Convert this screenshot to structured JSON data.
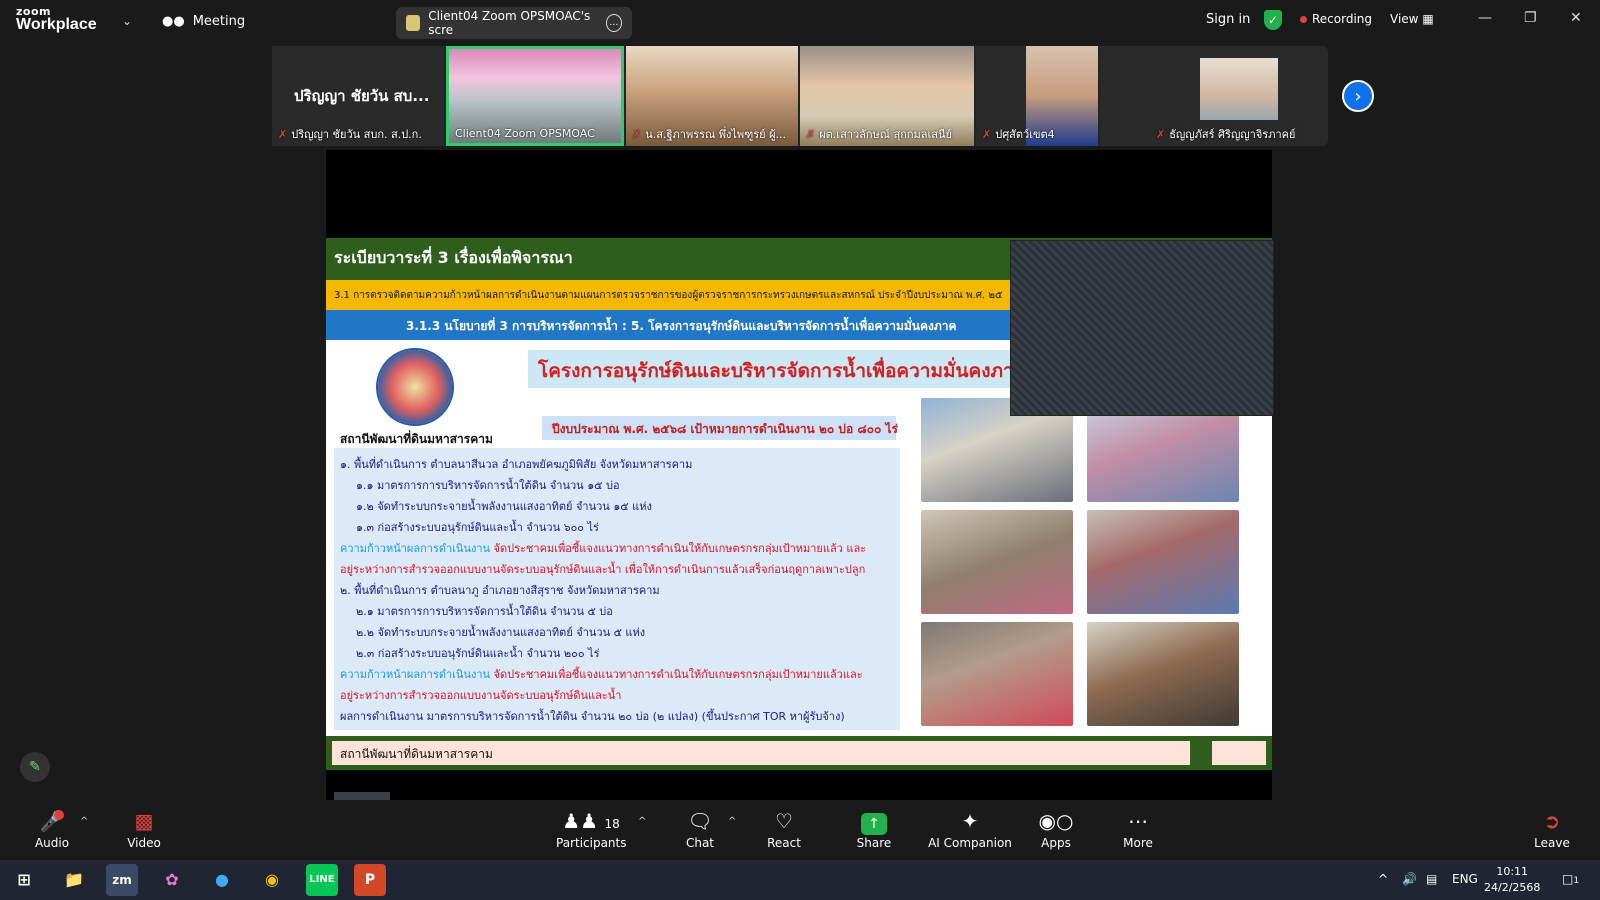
{
  "app": {
    "logo_line1": "zoom",
    "logo_line2": "Workplace",
    "meeting_label": "Meeting",
    "share_pill": "Client04 Zoom OPSMOAC's scre",
    "sign_in": "Sign in",
    "recording": "Recording",
    "view": "View"
  },
  "participants_strip": {
    "big_name": "ปริญญา ชัยวัน สบ...",
    "thumbs": [
      {
        "name": "ปริญญา ชัยวัน สบก. ส.ป.ก.",
        "muted": true
      },
      {
        "name": "Client04 Zoom OPSMOAC",
        "muted": false
      },
      {
        "name": "น.ส.ฐิภาพรรณ พึ่งไพฑูรย์ ผู้...",
        "muted": true
      },
      {
        "name": "ผต.เสาวลักษณ์ สุกกมลเสนีย์",
        "muted": true
      },
      {
        "name": "ปศุสัตว์เขต4",
        "muted": true
      },
      {
        "name": "ธัญญภัสร์ ศิริญญาจิรภาคย์",
        "muted": true
      }
    ]
  },
  "slide": {
    "header": "ระเบียบวาระที่ 3 เรื่องเพื่อพิจารณา",
    "yellow_bar": "3.1 การตรวจติดตามความก้าวหน้าผลการดำเนินงานตามแผนการตรวจราชการของผู้ตรวจราชการกระทรวงเกษตรและสหกรณ์ ประจำปีงบประมาณ พ.ศ. ๒๕",
    "blue_bar": "3.1.3 นโยบายที่ 3 การบริหารจัดการน้ำ : 5. โครงการอนุรักษ์ดินและบริหารจัดการน้ำเพื่อความมั่นคงภาค",
    "station_top": "สถานีพัฒนาที่ดินมหาสารคาม",
    "title": "โครงการอนุรักษ์ดินและบริหารจัดการน้ำเพื่อความมั่นคงภาคกา",
    "budget": "ปีงบประมาณ พ.ศ. ๒๕๖๘  เป้าหมายการดำเนินงาน ๒๐ บ่อ  ๘๐๐ ไร่",
    "lines": [
      {
        "text": "๑. พื้นที่ดำเนินการ  ตำบลนาสีนวล  อำเภอพยัคฆภูมิพิสัย  จังหวัดมหาสารคาม",
        "indent": false
      },
      {
        "text": "๑.๑ มาตรการการบริหารจัดการน้ำใต้ดิน จำนวน ๑๕ บ่อ",
        "indent": true
      },
      {
        "text": "๑.๒ จัดทำระบบกระจายน้ำพลังงานแสงอาทิตย์ จำนวน ๑๕ แห่ง",
        "indent": true
      },
      {
        "text": "๑.๓ ก่อสร้างระบบอนุรักษ์ดินและน้ำ จำนวน  ๖๐๐ ไร่",
        "indent": true
      },
      {
        "label": "ความก้าวหน้าผลการดำเนินงาน",
        "text": " จัดประชาคมเพื่อชี้แจงแนวทางการดำเนินให้กับเกษตรกรกลุ่มเป้าหมายแล้ว และ",
        "red": true
      },
      {
        "text": "อยู่ระหว่างการสำรวจออกแบบงานจัดระบบอนุรักษ์ดินและน้ำ  เพื่อให้การดำเนินการแล้วเสร็จก่อนฤดูกาลเพาะปลูก",
        "red": true
      },
      {
        "text": "๒. พื้นที่ดำเนินการ  ตำบลนาภู  อำเภอยางสีสุราช จังหวัดมหาสารคาม",
        "indent": false
      },
      {
        "text": "๒.๑ มาตรการการบริหารจัดการน้ำใต้ดิน จำนวน ๕ บ่อ",
        "indent": true
      },
      {
        "text": "๒.๒ จัดทำระบบกระจายน้ำพลังงานแสงอาทิตย์  จำนวน ๕ แห่ง",
        "indent": true
      },
      {
        "text": "๒.๓ ก่อสร้างระบบอนุรักษ์ดินและน้ำ  จำนวน  ๒๐๐ ไร่",
        "indent": true
      },
      {
        "label": "ความก้าวหน้าผลการดำเนินงาน",
        "text": "  จัดประชาคมเพื่อชี้แจงแนวทางการดำเนินให้กับเกษตรกรกลุ่มเป้าหมายแล้วและ",
        "red": true
      },
      {
        "text": "อยู่ระหว่างการสำรวจออกแบบงานจัดระบบอนุรักษ์ดินและน้ำ",
        "red": true
      },
      {
        "text": "ผลการดำเนินงาน  มาตรการบริหารจัดการน้ำใต้ดิน จำนวน ๒๐ บ่อ (๒ แปลง)  (ขึ้นประกาศ TOR หาผู้รับจ้าง)",
        "indent": false
      }
    ],
    "footer": "สถานีพัฒนาที่ดินมหาสารคาม"
  },
  "toolbar": {
    "audio": "Audio",
    "video": "Video",
    "participants": "Participants",
    "participants_count": "18",
    "chat": "Chat",
    "react": "React",
    "share": "Share",
    "ai": "AI Companion",
    "apps": "Apps",
    "more": "More",
    "leave": "Leave"
  },
  "taskbar": {
    "lang": "ENG",
    "time": "10:11",
    "date": "24/2/2568",
    "notif": "1"
  },
  "colors": {
    "accent_green": "#2ecc71",
    "zoom_blue": "#0e72ed",
    "slide_green": "#2e5d1c"
  }
}
